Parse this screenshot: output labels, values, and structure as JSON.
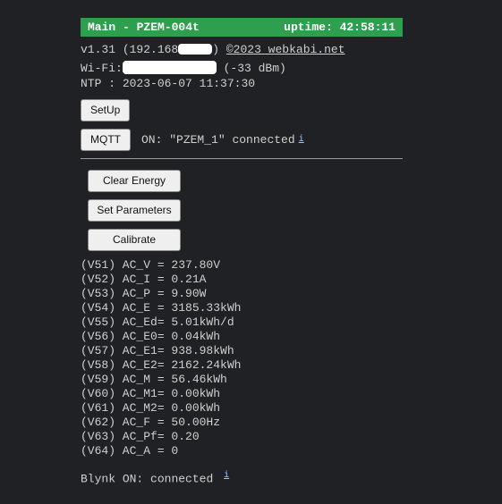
{
  "title": {
    "main": "Main - PZEM-004t",
    "uptime_label": "uptime:",
    "uptime_value": "42:58:11"
  },
  "info": {
    "version": "v1.31",
    "ip_prefix": "(192.168",
    "ip_suffix": ")",
    "link": "©2023 webkabi.net",
    "wifi_label": "Wi-Fi:",
    "wifi_signal": "(-33 dBm)",
    "ntp_label": "NTP   :",
    "ntp_value": "2023-06-07 11:37:30"
  },
  "buttons": {
    "setup": "SetUp",
    "mqtt": "MQTT",
    "clear_energy": "Clear Energy",
    "set_parameters": "Set Parameters",
    "calibrate": "Calibrate"
  },
  "mqtt": {
    "status_on": "ON:",
    "topic": "\"PZEM_1\"",
    "state": "connected",
    "info_char": "i"
  },
  "readings": [
    {
      "id": "V51",
      "name": "AC_V ",
      "eq": "=",
      "value": "237.80",
      "unit": "V"
    },
    {
      "id": "V52",
      "name": "AC_I ",
      "eq": "=",
      "value": "0.21",
      "unit": "A"
    },
    {
      "id": "V53",
      "name": "AC_P ",
      "eq": "=",
      "value": "9.90",
      "unit": "W"
    },
    {
      "id": "V54",
      "name": "AC_E ",
      "eq": "=",
      "value": "3185.33",
      "unit": "kWh"
    },
    {
      "id": "V55",
      "name": "AC_Ed",
      "eq": "=",
      "value": "5.01",
      "unit": "kWh/d"
    },
    {
      "id": "V56",
      "name": "AC_E0",
      "eq": "=",
      "value": "0.04",
      "unit": "kWh"
    },
    {
      "id": "V57",
      "name": "AC_E1",
      "eq": "=",
      "value": "938.98",
      "unit": "kWh"
    },
    {
      "id": "V58",
      "name": "AC_E2",
      "eq": "=",
      "value": "2162.24",
      "unit": "kWh"
    },
    {
      "id": "V59",
      "name": "AC_M ",
      "eq": "=",
      "value": "56.46",
      "unit": "kWh"
    },
    {
      "id": "V60",
      "name": "AC_M1",
      "eq": "=",
      "value": "0.00",
      "unit": "kWh"
    },
    {
      "id": "V61",
      "name": "AC_M2",
      "eq": "=",
      "value": "0.00",
      "unit": "kWh"
    },
    {
      "id": "V62",
      "name": "AC_F ",
      "eq": "=",
      "value": "50.00",
      "unit": "Hz"
    },
    {
      "id": "V63",
      "name": "AC_Pf",
      "eq": "=",
      "value": "0.20",
      "unit": ""
    },
    {
      "id": "V64",
      "name": "AC_A ",
      "eq": "=",
      "value": "0",
      "unit": ""
    }
  ],
  "blynk": {
    "label": "Blynk",
    "on": "ON:",
    "state": "connected",
    "info_char": "i"
  }
}
